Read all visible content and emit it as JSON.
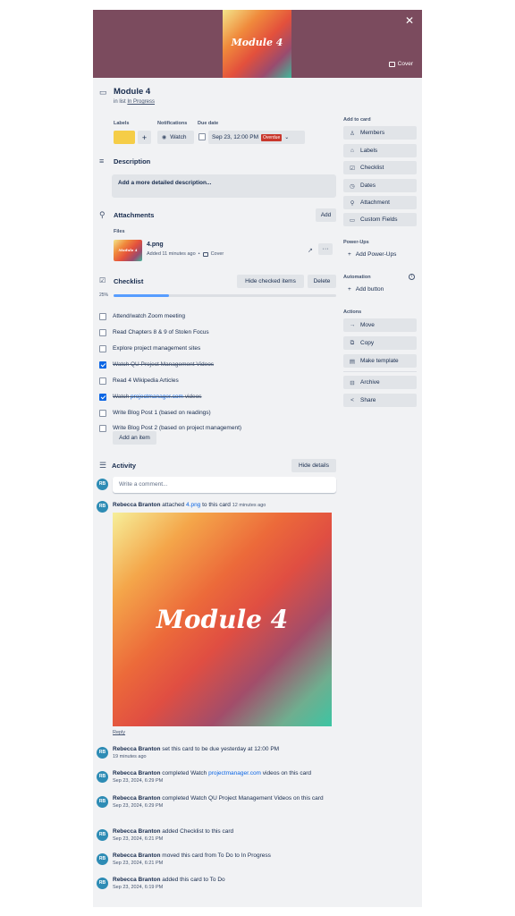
{
  "cover": {
    "image_text": "Module 4",
    "cover_label": "Cover"
  },
  "card": {
    "title": "Module 4",
    "in_list_prefix": "in list",
    "list_name": "In Progress"
  },
  "labels": {
    "heading": "Labels",
    "color": "#f5cd47",
    "add": "+"
  },
  "notifications": {
    "heading": "Notifications",
    "watch": "Watch"
  },
  "due": {
    "heading": "Due date",
    "value": "Sep 23, 12:00 PM",
    "badge": "Overdue"
  },
  "description": {
    "heading": "Description",
    "placeholder": "Add a more detailed description..."
  },
  "attachments": {
    "heading": "Attachments",
    "add": "Add",
    "files_heading": "Files",
    "file": {
      "name": "4.png",
      "meta": "Added 11 minutes ago",
      "cover": "Cover",
      "thumb_text": "Module 4"
    }
  },
  "checklist": {
    "heading": "Checklist",
    "hide_checked": "Hide checked items",
    "delete": "Delete",
    "progress": "25%",
    "progress_fraction": 0.25,
    "items": [
      {
        "text": "Attend/watch Zoom meeting",
        "checked": false
      },
      {
        "text": "Read Chapters 8 & 9 of Stolen Focus",
        "checked": false
      },
      {
        "text": "Explore project management sites",
        "checked": false
      },
      {
        "text": "Watch QU Project Management Videos",
        "checked": true
      },
      {
        "text": "Read 4 Wikipedia Articles",
        "checked": false
      },
      {
        "text_prefix": "Watch",
        "text_link": "projectmanager.com",
        "text_suffix": "videos",
        "checked": true
      },
      {
        "text": "Write Blog Post 1 (based on readings)",
        "checked": false
      },
      {
        "text": "Write Blog Post 2 (based on project management)",
        "checked": false
      }
    ],
    "add_item": "Add an item"
  },
  "activity": {
    "heading": "Activity",
    "hide_details": "Hide details",
    "comment_placeholder": "Write a comment...",
    "initials": "RB",
    "attach": {
      "user": "Rebecca Branton",
      "pre": "attached",
      "file": "4.png",
      "post": "to this card",
      "time": "12 minutes ago",
      "image_text": "Module 4",
      "reply": "Reply"
    },
    "entries": [
      {
        "user": "Rebecca Branton",
        "text": "set this card to be due yesterday at 12:00 PM",
        "time": "19 minutes ago"
      },
      {
        "user": "Rebecca Branton",
        "text": "completed Watch",
        "link": "projectmanager.com",
        "text2": "videos on this card",
        "time": "Sep 23, 2024, 6:29 PM"
      },
      {
        "user": "Rebecca Branton",
        "text": "completed Watch QU Project Management Videos on this card",
        "time": "Sep 23, 2024, 6:29 PM"
      },
      {
        "user": "Rebecca Branton",
        "text": "added Checklist to this card",
        "time": "Sep 23, 2024, 6:21 PM"
      },
      {
        "user": "Rebecca Branton",
        "text": "moved this card from To Do to In Progress",
        "time": "Sep 23, 2024, 6:21 PM"
      },
      {
        "user": "Rebecca Branton",
        "text": "added this card to To Do",
        "time": "Sep 23, 2024, 6:19 PM"
      }
    ]
  },
  "sidebar": {
    "add_to_card": "Add to card",
    "members": "Members",
    "labels": "Labels",
    "checklist": "Checklist",
    "dates": "Dates",
    "attachment": "Attachment",
    "custom_fields": "Custom Fields",
    "powerups": "Power-Ups",
    "add_powerups": "Add Power-Ups",
    "automation": "Automation",
    "add_button": "Add button",
    "actions": "Actions",
    "move": "Move",
    "copy": "Copy",
    "make_template": "Make template",
    "archive": "Archive",
    "share": "Share"
  }
}
